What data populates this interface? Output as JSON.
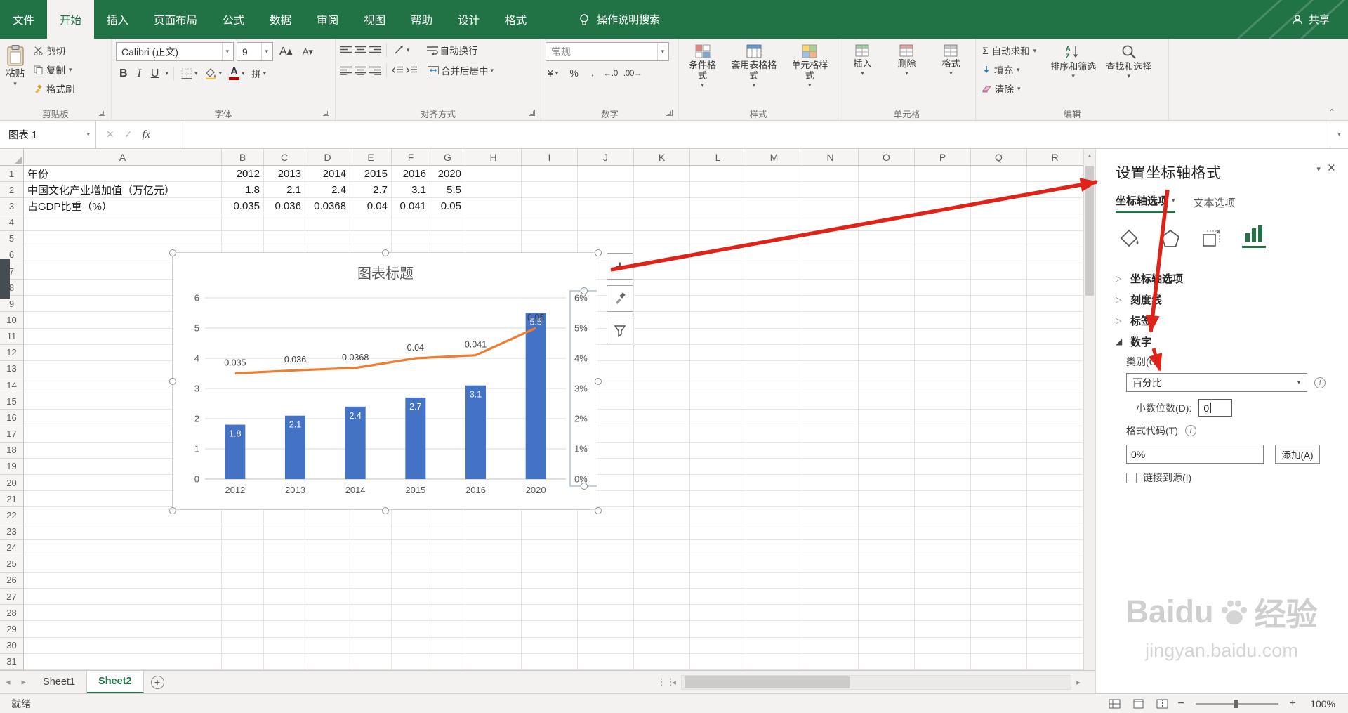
{
  "colors": {
    "theme_green": "#217346",
    "bar_blue": "#4472c4",
    "line_orange": "#ed7d31",
    "arrow_red": "#df2318",
    "font_color_red": "#c00000",
    "fill_yellow": "#f2c53d"
  },
  "menu": {
    "tabs": [
      "文件",
      "开始",
      "插入",
      "页面布局",
      "公式",
      "数据",
      "审阅",
      "视图",
      "帮助",
      "设计",
      "格式"
    ],
    "active_index": 1,
    "search_label": "操作说明搜索",
    "share_label": "共享"
  },
  "glyphs": {
    "bold": "B",
    "italic": "I",
    "underline": "U",
    "font_letter": "A",
    "grow_font": "A▴",
    "shrink_font": "A▾",
    "phonetic": "拼",
    "autosum": "Σ",
    "currency": "¥",
    "percent": "%",
    "comma": ",",
    "increase_decimal": "←.0",
    "decrease_decimal": ".00→",
    "plus": "+"
  },
  "ribbon": {
    "clipboard": {
      "label": "剪贴板",
      "paste": "粘贴",
      "cut": "剪切",
      "copy": "复制",
      "format_painter": "格式刷"
    },
    "font": {
      "label": "字体",
      "font_name": "Calibri (正文)",
      "font_size": "9"
    },
    "alignment": {
      "label": "对齐方式",
      "wrap_text": "自动换行",
      "merge_center": "合并后居中"
    },
    "number": {
      "label": "数字",
      "format": "常规"
    },
    "styles": {
      "label": "样式",
      "conditional": "条件格式",
      "format_as_table": "套用表格格式",
      "cell_styles": "单元格样式"
    },
    "cells": {
      "label": "单元格",
      "insert": "插入",
      "delete": "删除",
      "format": "格式"
    },
    "editing": {
      "label": "编辑",
      "autosum": "自动求和",
      "fill": "填充",
      "clear": "清除",
      "sort_filter": "排序和筛选",
      "find_select": "查找和选择"
    }
  },
  "formula_bar": {
    "name_box": "图表 1",
    "fx_label": "fx",
    "value": ""
  },
  "grid": {
    "columns": [
      "A",
      "B",
      "C",
      "D",
      "E",
      "F",
      "G",
      "H",
      "I",
      "J",
      "K",
      "L",
      "M",
      "N",
      "O",
      "P",
      "Q",
      "R"
    ],
    "row_count": 31,
    "cell_rows": [
      {
        "row": 1,
        "cells": [
          {
            "col": "A",
            "v": "年份"
          },
          {
            "col": "B",
            "v": "2012"
          },
          {
            "col": "C",
            "v": "2013"
          },
          {
            "col": "D",
            "v": "2014"
          },
          {
            "col": "E",
            "v": "2015"
          },
          {
            "col": "F",
            "v": "2016"
          },
          {
            "col": "G",
            "v": "2020"
          }
        ]
      },
      {
        "row": 2,
        "cells": [
          {
            "col": "A",
            "v": "中国文化产业增加值（万亿元）"
          },
          {
            "col": "B",
            "v": "1.8"
          },
          {
            "col": "C",
            "v": "2.1"
          },
          {
            "col": "D",
            "v": "2.4"
          },
          {
            "col": "E",
            "v": "2.7"
          },
          {
            "col": "F",
            "v": "3.1"
          },
          {
            "col": "G",
            "v": "5.5"
          }
        ]
      },
      {
        "row": 3,
        "cells": [
          {
            "col": "A",
            "v": "占GDP比重（%）"
          },
          {
            "col": "B",
            "v": "0.035"
          },
          {
            "col": "C",
            "v": "0.036"
          },
          {
            "col": "D",
            "v": "0.0368"
          },
          {
            "col": "E",
            "v": "0.04"
          },
          {
            "col": "F",
            "v": "0.041"
          },
          {
            "col": "G",
            "v": "0.05"
          }
        ]
      }
    ]
  },
  "chart_data": {
    "type": "combo",
    "title": "图表标题",
    "categories": [
      "2012",
      "2013",
      "2014",
      "2015",
      "2016",
      "2020"
    ],
    "series": [
      {
        "name": "中国文化产业增加值（万亿元）",
        "type": "bar",
        "axis": "left",
        "color": "#4472c4",
        "values": [
          1.8,
          2.1,
          2.4,
          2.7,
          3.1,
          5.5
        ],
        "labels": [
          "1.8",
          "2.1",
          "2.4",
          "2.7",
          "3.1",
          "5.5"
        ]
      },
      {
        "name": "占GDP比重（%）",
        "type": "line",
        "axis": "right",
        "color": "#ed7d31",
        "values": [
          0.035,
          0.036,
          0.0368,
          0.04,
          0.041,
          0.05
        ],
        "labels": [
          "0.035",
          "0.036",
          "0.0368",
          "0.04",
          "0.041",
          "0.05"
        ]
      }
    ],
    "left_axis": {
      "min": 0,
      "max": 6,
      "ticks": [
        "0",
        "1",
        "2",
        "3",
        "4",
        "5",
        "6"
      ]
    },
    "right_axis": {
      "min": 0,
      "max": 0.06,
      "ticks": [
        "0%",
        "1%",
        "2%",
        "3%",
        "4%",
        "5%",
        "6%"
      ]
    },
    "grid_on": true,
    "legend": "none"
  },
  "chart_buttons": [
    "plus-icon",
    "brush-icon",
    "funnel-icon"
  ],
  "task_pane": {
    "title": "设置坐标轴格式",
    "tabs": [
      {
        "label": "坐标轴选项",
        "active": true
      },
      {
        "label": "文本选项",
        "active": false
      }
    ],
    "icons": [
      "fill-line-icon",
      "effects-icon",
      "size-properties-icon",
      "chart-options-icon"
    ],
    "active_icon_index": 3,
    "sections": [
      {
        "label": "坐标轴选项",
        "expanded": false
      },
      {
        "label": "刻度线",
        "expanded": false
      },
      {
        "label": "标签",
        "expanded": false
      },
      {
        "label": "数字",
        "expanded": true
      }
    ],
    "number": {
      "category_label": "类别(C)",
      "category_value": "百分比",
      "decimals_label": "小数位数(D):",
      "decimals_value": "0",
      "format_code_label": "格式代码(T)",
      "format_code_value": "0%",
      "add_button": "添加(A)",
      "link_label": "链接到源(I)"
    }
  },
  "sheet_bar": {
    "sheets": [
      {
        "name": "Sheet1",
        "active": false
      },
      {
        "name": "Sheet2",
        "active": true
      }
    ]
  },
  "status_bar": {
    "ready": "就绪",
    "zoom": "100%"
  },
  "watermark": {
    "brand_en": "Baidu",
    "brand_cn": "经验",
    "url": "jingyan.baidu.com"
  }
}
